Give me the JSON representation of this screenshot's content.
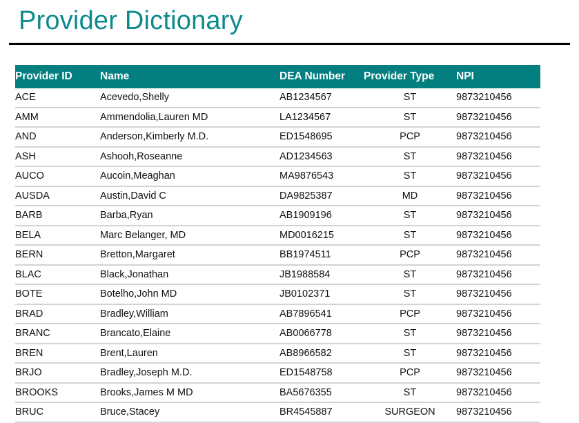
{
  "page": {
    "title": "Provider Dictionary"
  },
  "table": {
    "columns": [
      {
        "key": "provider_id",
        "label": "Provider ID"
      },
      {
        "key": "name",
        "label": "Name"
      },
      {
        "key": "dea_number",
        "label": "DEA Number"
      },
      {
        "key": "provider_type",
        "label": "Provider Type"
      },
      {
        "key": "npi",
        "label": "NPI"
      }
    ],
    "rows": [
      {
        "provider_id": "ACE",
        "name": "Acevedo,Shelly",
        "dea_number": "AB1234567",
        "provider_type": "ST",
        "npi": "9873210456"
      },
      {
        "provider_id": "AMM",
        "name": "Ammendolia,Lauren MD",
        "dea_number": "LA1234567",
        "provider_type": "ST",
        "npi": "9873210456"
      },
      {
        "provider_id": "AND",
        "name": "Anderson,Kimberly M.D.",
        "dea_number": "ED1548695",
        "provider_type": "PCP",
        "npi": "9873210456"
      },
      {
        "provider_id": "ASH",
        "name": "Ashooh,Roseanne",
        "dea_number": "AD1234563",
        "provider_type": "ST",
        "npi": "9873210456"
      },
      {
        "provider_id": "AUCO",
        "name": "Aucoin,Meaghan",
        "dea_number": "MA9876543",
        "provider_type": "ST",
        "npi": "9873210456"
      },
      {
        "provider_id": "AUSDA",
        "name": "Austin,David C",
        "dea_number": "DA9825387",
        "provider_type": "MD",
        "npi": "9873210456"
      },
      {
        "provider_id": "BARB",
        "name": "Barba,Ryan",
        "dea_number": "AB1909196",
        "provider_type": "ST",
        "npi": "9873210456"
      },
      {
        "provider_id": "BELA",
        "name": "Marc Belanger, MD",
        "dea_number": "MD0016215",
        "provider_type": "ST",
        "npi": "9873210456"
      },
      {
        "provider_id": "BERN",
        "name": "Bretton,Margaret",
        "dea_number": "BB1974511",
        "provider_type": "PCP",
        "npi": "9873210456"
      },
      {
        "provider_id": "BLAC",
        "name": "Black,Jonathan",
        "dea_number": "JB1988584",
        "provider_type": "ST",
        "npi": "9873210456"
      },
      {
        "provider_id": "BOTE",
        "name": "Botelho,John MD",
        "dea_number": "JB0102371",
        "provider_type": "ST",
        "npi": "9873210456"
      },
      {
        "provider_id": "BRAD",
        "name": "Bradley,William",
        "dea_number": "AB7896541",
        "provider_type": "PCP",
        "npi": "9873210456"
      },
      {
        "provider_id": "BRANC",
        "name": "Brancato,Elaine",
        "dea_number": "AB0066778",
        "provider_type": "ST",
        "npi": "9873210456"
      },
      {
        "provider_id": "BREN",
        "name": "Brent,Lauren",
        "dea_number": "AB8966582",
        "provider_type": "ST",
        "npi": "9873210456"
      },
      {
        "provider_id": "BRJO",
        "name": "Bradley,Joseph M.D.",
        "dea_number": "ED1548758",
        "provider_type": "PCP",
        "npi": "9873210456"
      },
      {
        "provider_id": "BROOKS",
        "name": "Brooks,James M MD",
        "dea_number": "BA5676355",
        "provider_type": "ST",
        "npi": "9873210456"
      },
      {
        "provider_id": "BRUC",
        "name": "Bruce,Stacey",
        "dea_number": "BR4545887",
        "provider_type": "SURGEON",
        "npi": "9873210456"
      }
    ]
  },
  "colors": {
    "title_teal": "#0d8a8e",
    "header_teal": "#047f80",
    "npi_link_blue": "#1414cc",
    "row_divider": "#d3d3d3",
    "title_rule": "#000000"
  }
}
